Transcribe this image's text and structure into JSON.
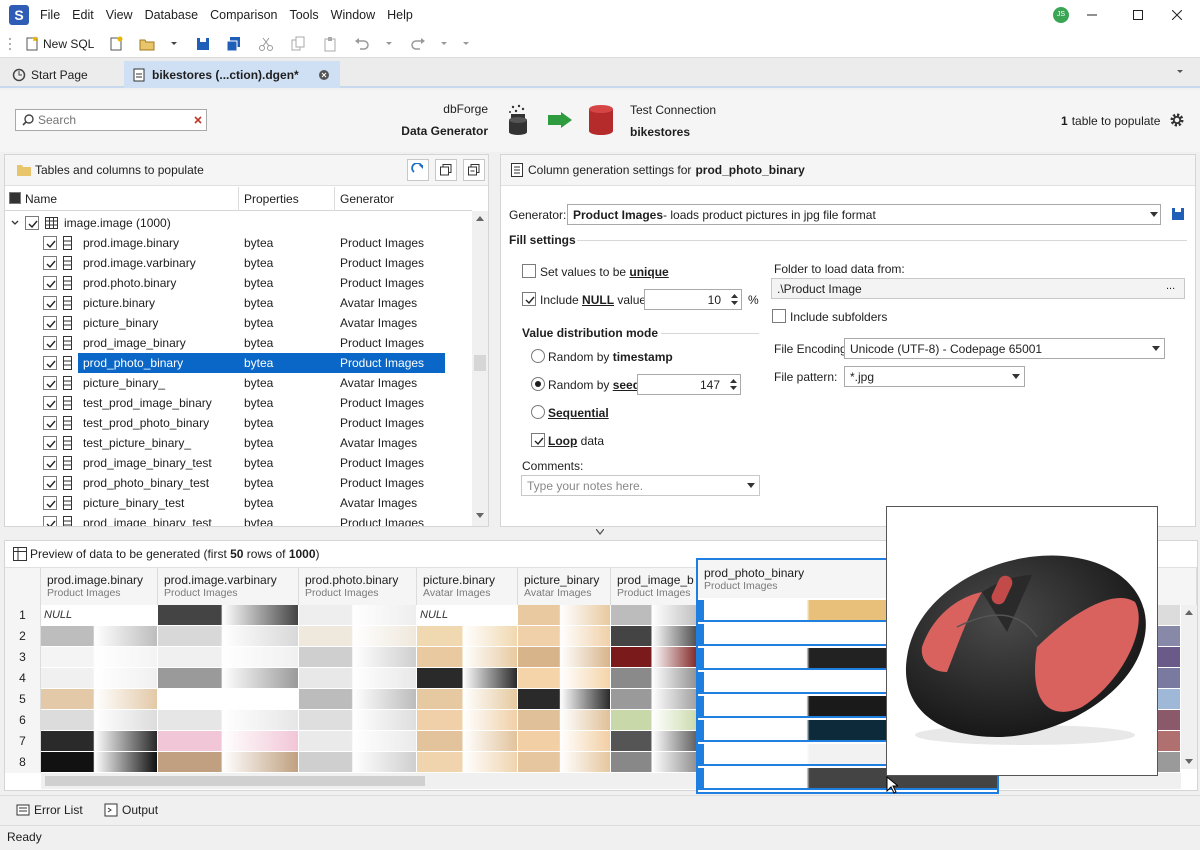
{
  "menubar": {
    "logo": "S",
    "items": [
      "File",
      "Edit",
      "View",
      "Database",
      "Comparison",
      "Tools",
      "Window",
      "Help"
    ],
    "user_initials": "JS"
  },
  "toolbar": {
    "new_sql": "New SQL"
  },
  "tabs": [
    {
      "label": "Start Page"
    },
    {
      "label": "bikestores (...ction).dgen*"
    }
  ],
  "header": {
    "search_placeholder": "Search",
    "app_line1": "dbForge",
    "app_line2": "Data Generator",
    "conn_label": "Test Connection",
    "conn_db": "bikestores",
    "populate_count": "1",
    "populate_text": "table to populate"
  },
  "left_panel": {
    "title": "Tables and columns to populate",
    "columns": [
      "Name",
      "Properties",
      "Generator"
    ],
    "table_name": "image.image (1000)",
    "rows": [
      {
        "name": "prod.image.binary",
        "prop": "bytea",
        "gen": "Product Images"
      },
      {
        "name": "prod.image.varbinary",
        "prop": "bytea",
        "gen": "Product Images"
      },
      {
        "name": "prod.photo.binary",
        "prop": "bytea",
        "gen": "Product Images"
      },
      {
        "name": "picture.binary",
        "prop": "bytea",
        "gen": "Avatar Images"
      },
      {
        "name": "picture_binary",
        "prop": "bytea",
        "gen": "Avatar Images"
      },
      {
        "name": "prod_image_binary",
        "prop": "bytea",
        "gen": "Product Images"
      },
      {
        "name": "prod_photo_binary",
        "prop": "bytea",
        "gen": "Product Images"
      },
      {
        "name": "picture_binary_",
        "prop": "bytea",
        "gen": "Avatar Images"
      },
      {
        "name": "test_prod_image_binary",
        "prop": "bytea",
        "gen": "Product Images"
      },
      {
        "name": "test_prod_photo_binary",
        "prop": "bytea",
        "gen": "Product Images"
      },
      {
        "name": "test_picture_binary_",
        "prop": "bytea",
        "gen": "Avatar Images"
      },
      {
        "name": "prod_image_binary_test",
        "prop": "bytea",
        "gen": "Product Images"
      },
      {
        "name": "prod_photo_binary_test",
        "prop": "bytea",
        "gen": "Product Images"
      },
      {
        "name": "picture_binary_test",
        "prop": "bytea",
        "gen": "Avatar Images"
      },
      {
        "name": "prod_image_binary_test",
        "prop": "bytea",
        "gen": "Product Images"
      }
    ]
  },
  "right_panel": {
    "title_prefix": "Column generation settings for",
    "title_column": "prod_photo_binary",
    "generator_label": "Generator:",
    "generator_name": "Product Images",
    "generator_desc": " - loads product pictures in jpg file format",
    "fill_settings": "Fill settings",
    "unique_label_a": "Set values to be ",
    "unique_label_b": "unique",
    "null_label_a": "Include ",
    "null_label_b": "NULL",
    "null_label_c": " values",
    "null_value": "10",
    "null_unit": "%",
    "dist_mode": "Value distribution mode",
    "random_ts_a": "Random by ",
    "random_ts_b": "timestamp",
    "random_seed_a": "Random by ",
    "random_seed_b": "seed",
    "seed_value": "147",
    "sequential": "Sequential",
    "loop_a": "Loop",
    "loop_b": " data",
    "comments_label": "Comments:",
    "comments_placeholder": "Type your notes here.",
    "folder_label": "Folder to load data from:",
    "folder_value": ".\\Product Image",
    "folder_browse": "...",
    "subfolders": "Include subfolders",
    "encoding_label": "File Encoding:",
    "encoding_value": "Unicode (UTF-8) - Codepage 65001",
    "pattern_label": "File pattern:",
    "pattern_value": "*.jpg"
  },
  "preview": {
    "title_a": "Preview of data to be generated (first ",
    "title_b": "50",
    "title_c": " rows of ",
    "title_d": "1000",
    "title_e": ")",
    "columns": [
      {
        "name": "prod.image.binary",
        "gen": "Product Images"
      },
      {
        "name": "prod.image.varbinary",
        "gen": "Product Images"
      },
      {
        "name": "prod.photo.binary",
        "gen": "Product Images"
      },
      {
        "name": "picture.binary",
        "gen": "Avatar Images"
      },
      {
        "name": "picture_binary",
        "gen": "Avatar Images"
      },
      {
        "name": "prod_image_bina",
        "gen": "Product Images"
      }
    ],
    "row_numbers": [
      "1",
      "2",
      "3",
      "4",
      "5",
      "6",
      "7",
      "8"
    ],
    "null_text": "NULL",
    "popup_col": "prod_photo_binary",
    "popup_gen": "Product Images"
  },
  "bottom": {
    "error_list": "Error List",
    "output": "Output",
    "status": "Ready"
  },
  "colors": {
    "accent": "#0a67c8",
    "brand": "#2f5db5",
    "db_red": "#b52b2b",
    "arrow_green": "#2e9c3e"
  }
}
